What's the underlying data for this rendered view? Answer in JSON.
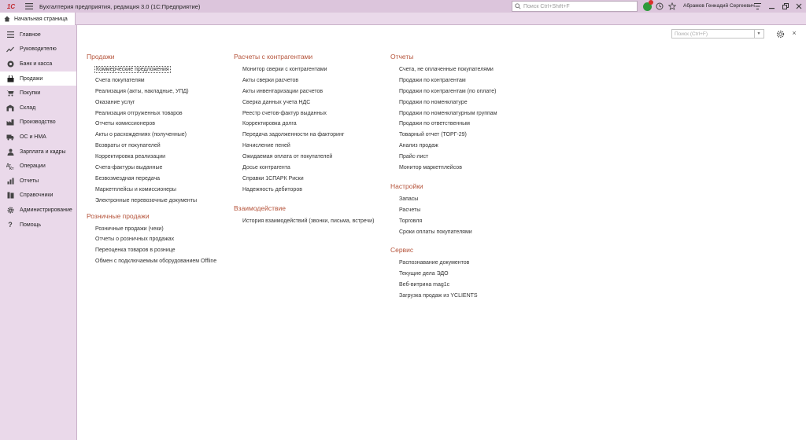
{
  "titlebar": {
    "logo": "1С",
    "title": "Бухгалтерия предприятия, редакция 3.0  (1С:Предприятие)",
    "search_placeholder": "Поиск Ctrl+Shift+F",
    "user": "Абрамов Геннадий Сергеевич"
  },
  "tabs": [
    {
      "label": "Начальная страница"
    }
  ],
  "sidebar": {
    "items": [
      {
        "label": "Главное",
        "icon": "menu-icon"
      },
      {
        "label": "Руководителю",
        "icon": "trend-icon"
      },
      {
        "label": "Банк и касса",
        "icon": "coin-icon"
      },
      {
        "label": "Продажи",
        "icon": "bag-icon"
      },
      {
        "label": "Покупки",
        "icon": "cart-icon"
      },
      {
        "label": "Склад",
        "icon": "warehouse-icon"
      },
      {
        "label": "Производство",
        "icon": "factory-icon"
      },
      {
        "label": "ОС и НМА",
        "icon": "truck-icon"
      },
      {
        "label": "Зарплата и кадры",
        "icon": "person-icon"
      },
      {
        "label": "Операции",
        "icon": "operations-icon"
      },
      {
        "label": "Отчеты",
        "icon": "report-icon"
      },
      {
        "label": "Справочники",
        "icon": "book-icon"
      },
      {
        "label": "Администрирование",
        "icon": "gear-icon"
      },
      {
        "label": "Помощь",
        "icon": "help-icon"
      }
    ],
    "active_index": 3
  },
  "main": {
    "search_placeholder": "Поиск (Ctrl+F)",
    "columns": [
      {
        "sections": [
          {
            "title": "Продажи",
            "links": [
              "Коммерческие предложения",
              "Счета покупателям",
              "Реализация (акты, накладные, УПД)",
              "Оказание услуг",
              "Реализация отгруженных товаров",
              "Отчеты комиссионеров",
              "Акты о расхождениях (полученные)",
              "Возвраты от покупателей",
              "Корректировка реализации",
              "Счета-фактуры выданные",
              "Безвозмездная передача",
              "Маркетплейсы и комиссионеры",
              "Электронные перевозочные документы"
            ]
          },
          {
            "title": "Розничные продажи",
            "links": [
              "Розничные продажи (чеки)",
              "Отчеты о розничных продажах",
              "Переоценка товаров в рознице",
              "Обмен с подключаемым оборудованием Offline"
            ]
          }
        ]
      },
      {
        "sections": [
          {
            "title": "Расчеты с контрагентами",
            "links": [
              "Монитор сверки с контрагентами",
              "Акты сверки расчетов",
              "Акты инвентаризации расчетов",
              "Сверка данных учета НДС",
              "Реестр счетов-фактур выданных",
              "Корректировка долга",
              "Передача задолженности на факторинг",
              "Начисление пеней",
              "Ожидаемая оплата от покупателей",
              "Досье контрагента",
              "Справки 1СПАРК Риски",
              "Надежность дебиторов"
            ]
          },
          {
            "title": "Взаимодействие",
            "links": [
              "История взаимодействий (звонки, письма, встречи)"
            ]
          }
        ]
      },
      {
        "sections": [
          {
            "title": "Отчеты",
            "links": [
              "Счета, не оплаченные покупателями",
              "Продажи по контрагентам",
              "Продажи по контрагентам (по оплате)",
              "Продажи по номенклатуре",
              "Продажи по номенклатурным группам",
              "Продажи по ответственным",
              "Товарный отчет (ТОРГ-29)",
              "Анализ продаж",
              "Прайс-лист",
              "Монитор маркетплейсов"
            ]
          },
          {
            "title": "Настройки",
            "links": [
              "Запасы",
              "Расчеты",
              "Торговля",
              "Сроки оплаты покупателями"
            ]
          },
          {
            "title": "Сервис",
            "links": [
              "Распознавание документов",
              "Текущие дела ЭДО",
              "Веб-витрина mag1c",
              "Загрузка продаж из YCLIENTS"
            ]
          }
        ]
      }
    ]
  },
  "colors": {
    "titlebar_bg": "#dcc5dc",
    "sidebar_bg": "#ead9ea",
    "section_title": "#b5533a"
  }
}
